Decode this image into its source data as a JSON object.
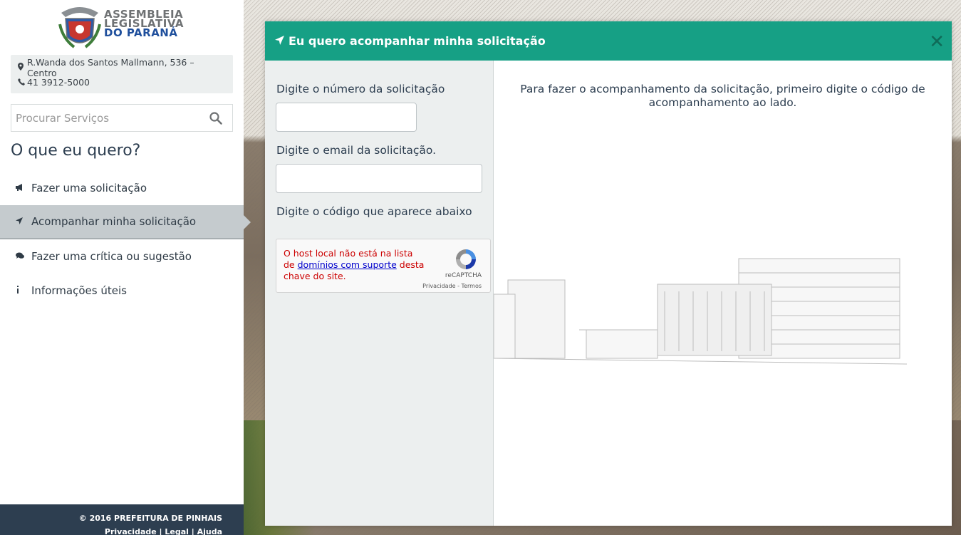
{
  "logo": {
    "line1": "ASSEMBLEIA",
    "line2": "LEGISLATIVA",
    "line3": "DO PARANÁ"
  },
  "contact": {
    "address": "R.Wanda dos Santos Mallmann, 536 – Centro",
    "phone": "41 3912-5000"
  },
  "search": {
    "placeholder": "Procurar Serviços"
  },
  "sidebar": {
    "heading": "O que eu quero?",
    "items": [
      {
        "label": "Fazer uma solicitação",
        "icon": "bullhorn-icon"
      },
      {
        "label": "Acompanhar minha solicitação",
        "icon": "location-arrow-icon",
        "active": true
      },
      {
        "label": "Fazer uma crítica ou sugestão",
        "icon": "comments-icon"
      },
      {
        "label": "Informações úteis",
        "icon": "info-icon"
      }
    ]
  },
  "footer": {
    "copyright": "© 2016 PREFEITURA DE PINHAIS",
    "links": "Privacidade | Legal | Ajuda"
  },
  "modal": {
    "title": "Eu quero acompanhar minha solicitação",
    "close_label": "✕",
    "number_label": "Digite o número da solicitação",
    "email_label": "Digite o email da solicitação.",
    "code_label": "Digite o código que aparece abaixo",
    "recaptcha": {
      "msg_before": "O host local não está na lista de ",
      "msg_link": "domínios com suporte",
      "msg_after": " desta chave do site.",
      "brand": "reCAPTCHA",
      "terms": "Privacidade - Termos"
    },
    "info_text": "Para fazer o acompanhamento da solicitação, primeiro digite o código de acompanhamento ao lado."
  },
  "colors": {
    "accent": "#16a085",
    "dark": "#2d3e50",
    "active_item": "#c5cbce"
  }
}
